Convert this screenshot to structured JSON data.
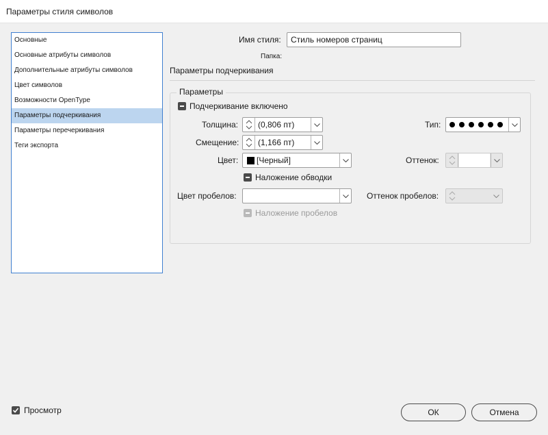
{
  "window": {
    "title": "Параметры стиля символов"
  },
  "nav": {
    "items": [
      {
        "label": "Основные"
      },
      {
        "label": "Основные атрибуты символов"
      },
      {
        "label": "Дополнительные атрибуты символов"
      },
      {
        "label": "Цвет символов"
      },
      {
        "label": "Возможности OpenType"
      },
      {
        "label": "Параметры подчеркивания",
        "selected": true
      },
      {
        "label": "Параметры перечеркивания"
      },
      {
        "label": "Теги экспорта"
      }
    ]
  },
  "header": {
    "style_name_label": "Имя стиля:",
    "style_name_value": "Стиль номеров страниц",
    "folder_label": "Папка:",
    "section_title": "Параметры подчеркивания"
  },
  "params": {
    "group_title": "Параметры",
    "underline_on_label": "Подчеркивание включено",
    "weight_label": "Толщина:",
    "weight_value": "(0,806 пт)",
    "offset_label": "Смещение:",
    "offset_value": "(1,166 пт)",
    "type_label": "Тип:",
    "color_label": "Цвет:",
    "color_value": "[Черный]",
    "tint_label": "Оттенок:",
    "overprint_stroke_label": "Наложение обводки",
    "gap_color_label": "Цвет пробелов:",
    "gap_tint_label": "Оттенок пробелов:",
    "overprint_gap_label": "Наложение пробелов"
  },
  "footer": {
    "preview_label": "Просмотр",
    "ok_label": "ОК",
    "cancel_label": "Отмена"
  },
  "colors": {
    "selection": "#bcd5ef",
    "focus_border": "#3f7fd0"
  },
  "icons": {
    "checkbox": "checkbox-icon",
    "spinner": "spinner-arrows-icon",
    "dropdown": "chevron-down-icon",
    "color_swatch": "color-swatch-icon",
    "stroke_type": "dotted-stroke-icon"
  }
}
